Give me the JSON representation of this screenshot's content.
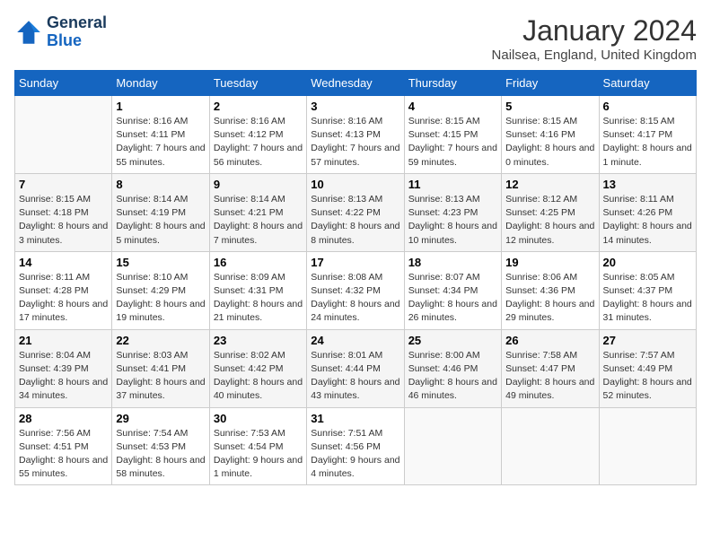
{
  "header": {
    "logo_general": "General",
    "logo_blue": "Blue",
    "title": "January 2024",
    "location": "Nailsea, England, United Kingdom"
  },
  "days_of_week": [
    "Sunday",
    "Monday",
    "Tuesday",
    "Wednesday",
    "Thursday",
    "Friday",
    "Saturday"
  ],
  "weeks": [
    [
      {
        "day": "",
        "sunrise": "",
        "sunset": "",
        "daylight": ""
      },
      {
        "day": "1",
        "sunrise": "Sunrise: 8:16 AM",
        "sunset": "Sunset: 4:11 PM",
        "daylight": "Daylight: 7 hours and 55 minutes."
      },
      {
        "day": "2",
        "sunrise": "Sunrise: 8:16 AM",
        "sunset": "Sunset: 4:12 PM",
        "daylight": "Daylight: 7 hours and 56 minutes."
      },
      {
        "day": "3",
        "sunrise": "Sunrise: 8:16 AM",
        "sunset": "Sunset: 4:13 PM",
        "daylight": "Daylight: 7 hours and 57 minutes."
      },
      {
        "day": "4",
        "sunrise": "Sunrise: 8:15 AM",
        "sunset": "Sunset: 4:15 PM",
        "daylight": "Daylight: 7 hours and 59 minutes."
      },
      {
        "day": "5",
        "sunrise": "Sunrise: 8:15 AM",
        "sunset": "Sunset: 4:16 PM",
        "daylight": "Daylight: 8 hours and 0 minutes."
      },
      {
        "day": "6",
        "sunrise": "Sunrise: 8:15 AM",
        "sunset": "Sunset: 4:17 PM",
        "daylight": "Daylight: 8 hours and 1 minute."
      }
    ],
    [
      {
        "day": "7",
        "sunrise": "Sunrise: 8:15 AM",
        "sunset": "Sunset: 4:18 PM",
        "daylight": "Daylight: 8 hours and 3 minutes."
      },
      {
        "day": "8",
        "sunrise": "Sunrise: 8:14 AM",
        "sunset": "Sunset: 4:19 PM",
        "daylight": "Daylight: 8 hours and 5 minutes."
      },
      {
        "day": "9",
        "sunrise": "Sunrise: 8:14 AM",
        "sunset": "Sunset: 4:21 PM",
        "daylight": "Daylight: 8 hours and 7 minutes."
      },
      {
        "day": "10",
        "sunrise": "Sunrise: 8:13 AM",
        "sunset": "Sunset: 4:22 PM",
        "daylight": "Daylight: 8 hours and 8 minutes."
      },
      {
        "day": "11",
        "sunrise": "Sunrise: 8:13 AM",
        "sunset": "Sunset: 4:23 PM",
        "daylight": "Daylight: 8 hours and 10 minutes."
      },
      {
        "day": "12",
        "sunrise": "Sunrise: 8:12 AM",
        "sunset": "Sunset: 4:25 PM",
        "daylight": "Daylight: 8 hours and 12 minutes."
      },
      {
        "day": "13",
        "sunrise": "Sunrise: 8:11 AM",
        "sunset": "Sunset: 4:26 PM",
        "daylight": "Daylight: 8 hours and 14 minutes."
      }
    ],
    [
      {
        "day": "14",
        "sunrise": "Sunrise: 8:11 AM",
        "sunset": "Sunset: 4:28 PM",
        "daylight": "Daylight: 8 hours and 17 minutes."
      },
      {
        "day": "15",
        "sunrise": "Sunrise: 8:10 AM",
        "sunset": "Sunset: 4:29 PM",
        "daylight": "Daylight: 8 hours and 19 minutes."
      },
      {
        "day": "16",
        "sunrise": "Sunrise: 8:09 AM",
        "sunset": "Sunset: 4:31 PM",
        "daylight": "Daylight: 8 hours and 21 minutes."
      },
      {
        "day": "17",
        "sunrise": "Sunrise: 8:08 AM",
        "sunset": "Sunset: 4:32 PM",
        "daylight": "Daylight: 8 hours and 24 minutes."
      },
      {
        "day": "18",
        "sunrise": "Sunrise: 8:07 AM",
        "sunset": "Sunset: 4:34 PM",
        "daylight": "Daylight: 8 hours and 26 minutes."
      },
      {
        "day": "19",
        "sunrise": "Sunrise: 8:06 AM",
        "sunset": "Sunset: 4:36 PM",
        "daylight": "Daylight: 8 hours and 29 minutes."
      },
      {
        "day": "20",
        "sunrise": "Sunrise: 8:05 AM",
        "sunset": "Sunset: 4:37 PM",
        "daylight": "Daylight: 8 hours and 31 minutes."
      }
    ],
    [
      {
        "day": "21",
        "sunrise": "Sunrise: 8:04 AM",
        "sunset": "Sunset: 4:39 PM",
        "daylight": "Daylight: 8 hours and 34 minutes."
      },
      {
        "day": "22",
        "sunrise": "Sunrise: 8:03 AM",
        "sunset": "Sunset: 4:41 PM",
        "daylight": "Daylight: 8 hours and 37 minutes."
      },
      {
        "day": "23",
        "sunrise": "Sunrise: 8:02 AM",
        "sunset": "Sunset: 4:42 PM",
        "daylight": "Daylight: 8 hours and 40 minutes."
      },
      {
        "day": "24",
        "sunrise": "Sunrise: 8:01 AM",
        "sunset": "Sunset: 4:44 PM",
        "daylight": "Daylight: 8 hours and 43 minutes."
      },
      {
        "day": "25",
        "sunrise": "Sunrise: 8:00 AM",
        "sunset": "Sunset: 4:46 PM",
        "daylight": "Daylight: 8 hours and 46 minutes."
      },
      {
        "day": "26",
        "sunrise": "Sunrise: 7:58 AM",
        "sunset": "Sunset: 4:47 PM",
        "daylight": "Daylight: 8 hours and 49 minutes."
      },
      {
        "day": "27",
        "sunrise": "Sunrise: 7:57 AM",
        "sunset": "Sunset: 4:49 PM",
        "daylight": "Daylight: 8 hours and 52 minutes."
      }
    ],
    [
      {
        "day": "28",
        "sunrise": "Sunrise: 7:56 AM",
        "sunset": "Sunset: 4:51 PM",
        "daylight": "Daylight: 8 hours and 55 minutes."
      },
      {
        "day": "29",
        "sunrise": "Sunrise: 7:54 AM",
        "sunset": "Sunset: 4:53 PM",
        "daylight": "Daylight: 8 hours and 58 minutes."
      },
      {
        "day": "30",
        "sunrise": "Sunrise: 7:53 AM",
        "sunset": "Sunset: 4:54 PM",
        "daylight": "Daylight: 9 hours and 1 minute."
      },
      {
        "day": "31",
        "sunrise": "Sunrise: 7:51 AM",
        "sunset": "Sunset: 4:56 PM",
        "daylight": "Daylight: 9 hours and 4 minutes."
      },
      {
        "day": "",
        "sunrise": "",
        "sunset": "",
        "daylight": ""
      },
      {
        "day": "",
        "sunrise": "",
        "sunset": "",
        "daylight": ""
      },
      {
        "day": "",
        "sunrise": "",
        "sunset": "",
        "daylight": ""
      }
    ]
  ]
}
